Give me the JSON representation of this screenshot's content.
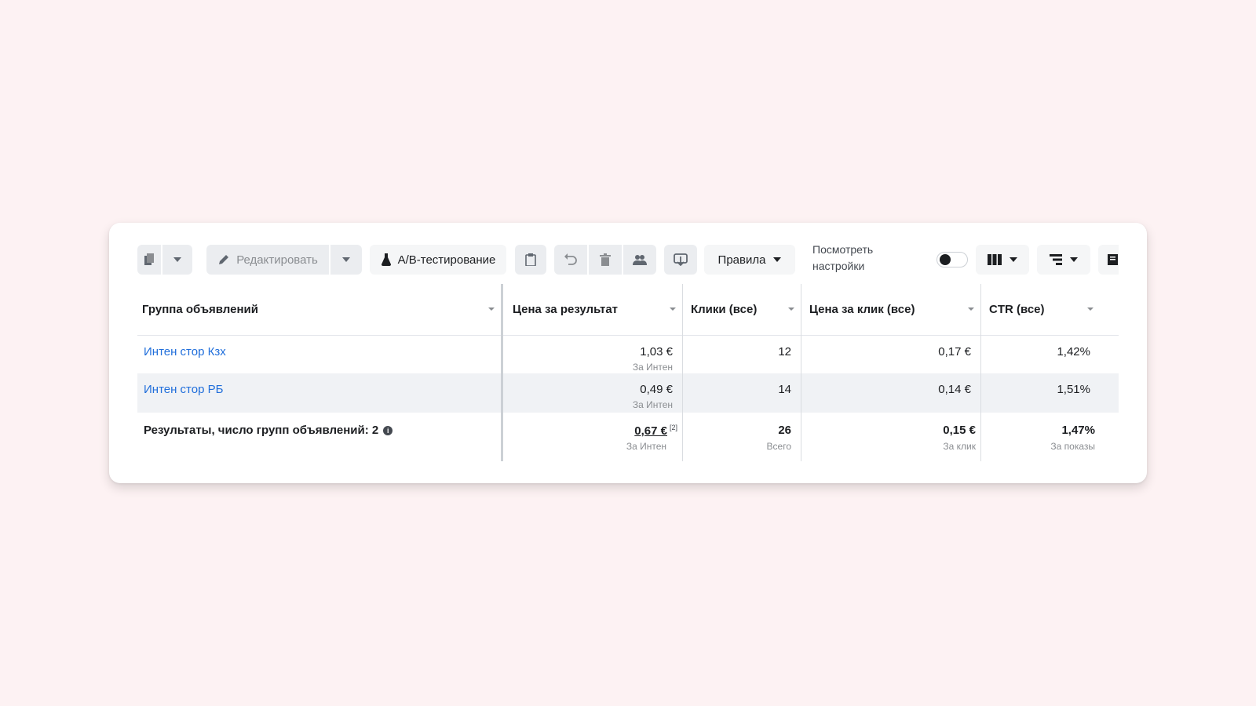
{
  "toolbar": {
    "edit_label": "Редактировать",
    "ab_test_label": "A/B-тестирование",
    "rules_label": "Правила",
    "view_settings_line1": "Посмотреть",
    "view_settings_line2": "настройки"
  },
  "table": {
    "headers": {
      "ad_group": "Группа объявлений",
      "cost_per_result": "Цена за результат",
      "clicks_all": "Клики (все)",
      "cpc_all": "Цена за клик (все)",
      "ctr_all": "CTR (все)"
    },
    "rows": [
      {
        "name": "Интен стор Кзх",
        "cost_per_result": "1,03 €",
        "cost_per_result_sub": "За Интен",
        "clicks": "12",
        "cpc": "0,17 €",
        "ctr": "1,42%"
      },
      {
        "name": "Интен стор РБ",
        "cost_per_result": "0,49 €",
        "cost_per_result_sub": "За Интен",
        "clicks": "14",
        "cpc": "0,14 €",
        "ctr": "1,51%"
      }
    ],
    "totals": {
      "label": "Результаты, число групп объявлений: 2",
      "cost_per_result": "0,67 €",
      "cost_per_result_mark": "[2]",
      "cost_per_result_sub": "За Интен",
      "clicks": "26",
      "clicks_sub": "Всего",
      "cpc": "0,15 €",
      "cpc_sub": "За клик",
      "ctr": "1,47%",
      "ctr_sub": "За показы"
    }
  },
  "colors": {
    "link": "#216fdb",
    "background": "#fdf2f3",
    "button": "#ebedf0"
  }
}
